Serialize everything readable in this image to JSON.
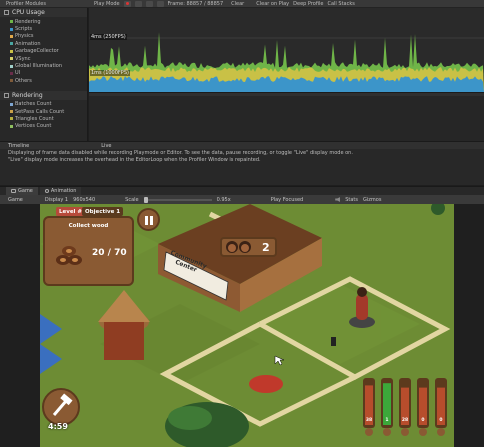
{
  "profiler_toolbar": {
    "modules_label": "Profiler Modules",
    "play_mode_label": "Play Mode",
    "frame_label": "Frame: 88857 / 88857",
    "clear_label": "Clear",
    "clear_on_play_label": "Clear on Play",
    "deep_profile_label": "Deep Profile",
    "call_stacks_label": "Call Stacks"
  },
  "cpu_module": {
    "title": "CPU Usage",
    "items": [
      {
        "label": "Rendering",
        "color": "#6fb548"
      },
      {
        "label": "Scripts",
        "color": "#3c95c9"
      },
      {
        "label": "Physics",
        "color": "#e0a84b"
      },
      {
        "label": "Animation",
        "color": "#4aa7a3"
      },
      {
        "label": "GarbageCollector",
        "color": "#c9c146"
      },
      {
        "label": "VSync",
        "color": "#d5d26a"
      },
      {
        "label": "Global Illumination",
        "color": "#a1d0cb"
      },
      {
        "label": "UI",
        "color": "#6a2d4a"
      },
      {
        "label": "Others",
        "color": "#7f5b3a"
      }
    ],
    "marker_4ms": "4ms (250FPS)",
    "marker_1ms": "1ms (1000FPS)"
  },
  "rendering_module": {
    "title": "Rendering",
    "items": [
      {
        "label": "Batches Count",
        "color": "#7fa6d1"
      },
      {
        "label": "SetPass Calls Count",
        "color": "#c9a14a"
      },
      {
        "label": "Triangles Count",
        "color": "#b7b040"
      },
      {
        "label": "Vertices Count",
        "color": "#8fbf60"
      }
    ]
  },
  "timeline": {
    "view_label": "Timeline",
    "live_label": "Live",
    "message_line1": "Displaying of frame data disabled while recording Playmode or Editor. To see the data, pause recording, or toggle \"Live\" display mode on.",
    "message_line2": "\"Live\" display mode increases the overhead in the EditorLoop when the Profiler Window is repainted."
  },
  "game_tabs": {
    "game_label": "Game",
    "animation_label": "Animation"
  },
  "game_toolbar": {
    "view_label": "Game",
    "display_label": "Display 1",
    "resolution_label": "960x540",
    "scale_label": "Scale",
    "scale_value": "0.95x",
    "play_focused_label": "Play Focused",
    "stats_label": "Stats",
    "gizmos_label": "Gizmos"
  },
  "hud": {
    "level_label": "Level #2",
    "objective_label": "Objective 1",
    "objective_title": "Collect wood",
    "objective_progress": "20 / 70",
    "population_count": "2",
    "building_sign_line1": "Community",
    "building_sign_line2": "Center",
    "timer": "4:59",
    "resource_bars": [
      {
        "value": "38",
        "fill": 0.9,
        "color": "#b74d2c"
      },
      {
        "value": "1",
        "fill": 0.95,
        "color": "#3ca83a"
      },
      {
        "value": "28",
        "fill": 0.85,
        "color": "#b74d2c"
      },
      {
        "value": "0",
        "fill": 0.85,
        "color": "#b74d2c"
      },
      {
        "value": "0",
        "fill": 0.85,
        "color": "#b74d2c"
      }
    ]
  }
}
